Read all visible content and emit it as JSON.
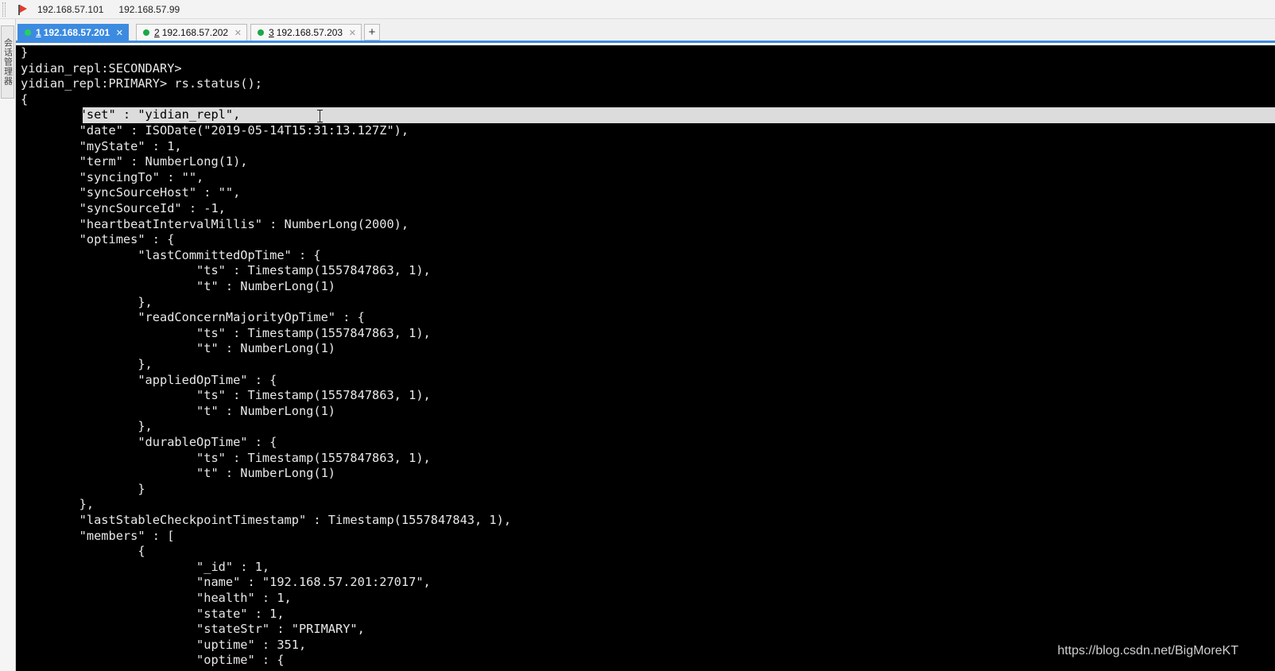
{
  "quick_connect": {
    "items": [
      "192.168.57.101",
      "192.168.57.99"
    ]
  },
  "side_panel": {
    "label": "会话管理器"
  },
  "tabs": [
    {
      "number": "1",
      "host": "192.168.57.201",
      "active": true,
      "status_color": "#22d35a"
    },
    {
      "number": "2",
      "host": "192.168.57.202",
      "active": false,
      "status_color": "#1aa84a"
    },
    {
      "number": "3",
      "host": "192.168.57.203",
      "active": false,
      "status_color": "#1aa84a"
    }
  ],
  "add_tab_label": "+",
  "terminal": {
    "selected_line_index": 4,
    "lines": [
      "}",
      "yidian_repl:SECONDARY>",
      "yidian_repl:PRIMARY> rs.status();",
      "{",
      "        \"set\" : \"yidian_repl\",",
      "        \"date\" : ISODate(\"2019-05-14T15:31:13.127Z\"),",
      "        \"myState\" : 1,",
      "        \"term\" : NumberLong(1),",
      "        \"syncingTo\" : \"\",",
      "        \"syncSourceHost\" : \"\",",
      "        \"syncSourceId\" : -1,",
      "        \"heartbeatIntervalMillis\" : NumberLong(2000),",
      "        \"optimes\" : {",
      "                \"lastCommittedOpTime\" : {",
      "                        \"ts\" : Timestamp(1557847863, 1),",
      "                        \"t\" : NumberLong(1)",
      "                },",
      "                \"readConcernMajorityOpTime\" : {",
      "                        \"ts\" : Timestamp(1557847863, 1),",
      "                        \"t\" : NumberLong(1)",
      "                },",
      "                \"appliedOpTime\" : {",
      "                        \"ts\" : Timestamp(1557847863, 1),",
      "                        \"t\" : NumberLong(1)",
      "                },",
      "                \"durableOpTime\" : {",
      "                        \"ts\" : Timestamp(1557847863, 1),",
      "                        \"t\" : NumberLong(1)",
      "                }",
      "        },",
      "        \"lastStableCheckpointTimestamp\" : Timestamp(1557847843, 1),",
      "        \"members\" : [",
      "                {",
      "                        \"_id\" : 1,",
      "                        \"name\" : \"192.168.57.201:27017\",",
      "                        \"health\" : 1,",
      "                        \"state\" : 1,",
      "                        \"stateStr\" : \"PRIMARY\",",
      "                        \"uptime\" : 351,",
      "                        \"optime\" : {"
    ]
  },
  "watermark": "https://blog.csdn.net/BigMoreKT"
}
